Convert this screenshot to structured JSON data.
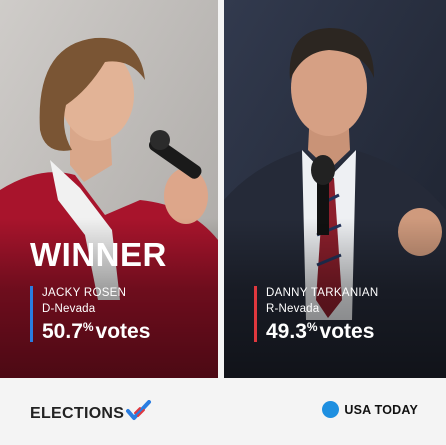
{
  "winner_label": "WINNER",
  "candidates": [
    {
      "name": "JACKY ROSEN",
      "party": "D-Nevada",
      "pct": "50.7",
      "pct_symbol": "%",
      "votes_label": "votes",
      "accent": "#2a7de1",
      "winner": true
    },
    {
      "name": "DANNY TARKANIAN",
      "party": "R-Nevada",
      "pct": "49.3",
      "pct_symbol": "%",
      "votes_label": "votes",
      "accent": "#e0383e",
      "winner": false
    }
  ],
  "footer": {
    "elections_label": "ELECTIONS",
    "elections_icon": "checkmark-flag-icon",
    "brand_label": "USA TODAY",
    "brand_dot_color": "#1e8fe0"
  }
}
